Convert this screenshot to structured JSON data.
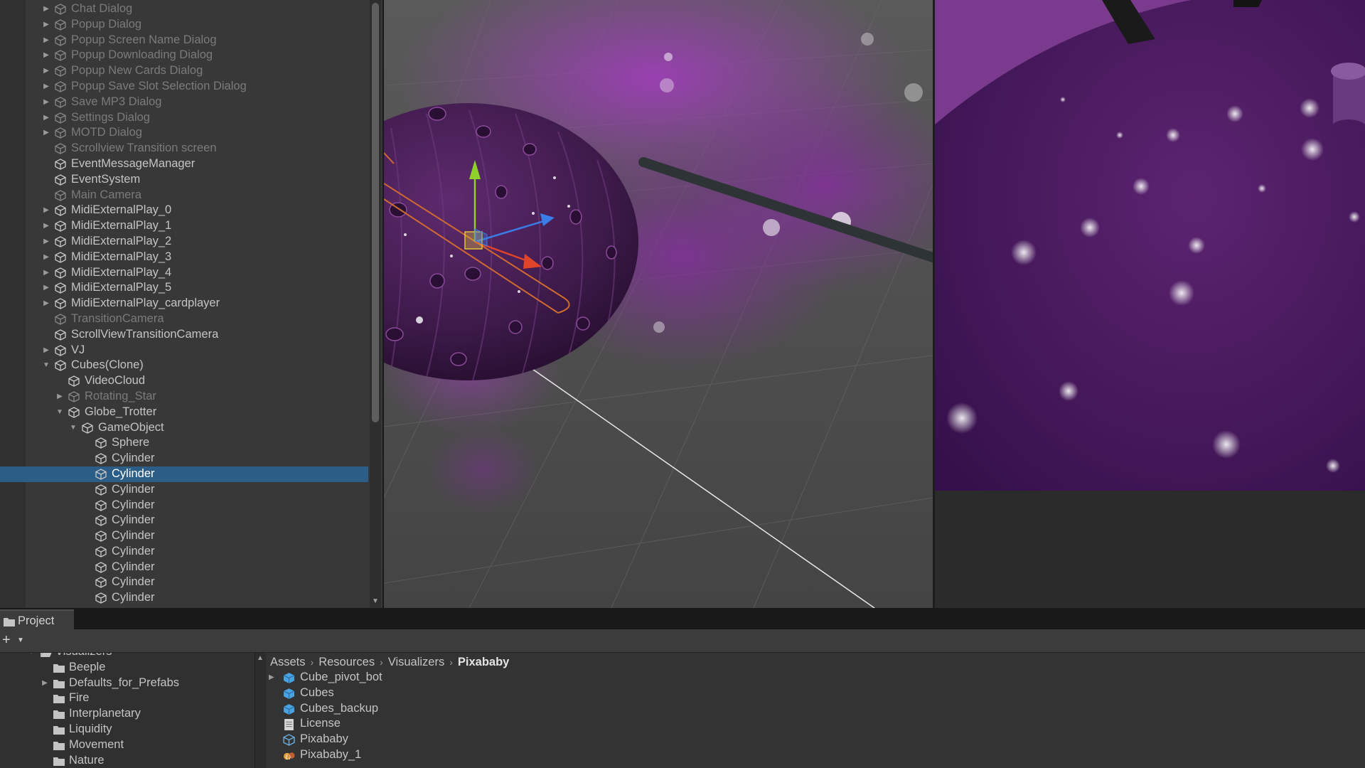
{
  "hierarchy": {
    "items": [
      {
        "label": "Chat Dialog",
        "depth": 0,
        "expander": "collapsed",
        "inactive": true
      },
      {
        "label": "Popup Dialog",
        "depth": 0,
        "expander": "collapsed",
        "inactive": true
      },
      {
        "label": "Popup Screen Name Dialog",
        "depth": 0,
        "expander": "collapsed",
        "inactive": true
      },
      {
        "label": "Popup Downloading Dialog",
        "depth": 0,
        "expander": "collapsed",
        "inactive": true
      },
      {
        "label": "Popup New Cards Dialog",
        "depth": 0,
        "expander": "collapsed",
        "inactive": true
      },
      {
        "label": "Popup Save Slot Selection Dialog",
        "depth": 0,
        "expander": "collapsed",
        "inactive": true
      },
      {
        "label": "Save MP3 Dialog",
        "depth": 0,
        "expander": "collapsed",
        "inactive": true
      },
      {
        "label": "Settings Dialog",
        "depth": 0,
        "expander": "collapsed",
        "inactive": true
      },
      {
        "label": "MOTD Dialog",
        "depth": 0,
        "expander": "collapsed",
        "inactive": true
      },
      {
        "label": "Scrollview Transition screen",
        "depth": 0,
        "expander": "none",
        "inactive": true
      },
      {
        "label": "EventMessageManager",
        "depth": 0,
        "expander": "none",
        "inactive": false
      },
      {
        "label": "EventSystem",
        "depth": 0,
        "expander": "none",
        "inactive": false
      },
      {
        "label": "Main Camera",
        "depth": 0,
        "expander": "none",
        "inactive": true
      },
      {
        "label": "MidiExternalPlay_0",
        "depth": 0,
        "expander": "collapsed",
        "inactive": false
      },
      {
        "label": "MidiExternalPlay_1",
        "depth": 0,
        "expander": "collapsed",
        "inactive": false
      },
      {
        "label": "MidiExternalPlay_2",
        "depth": 0,
        "expander": "collapsed",
        "inactive": false
      },
      {
        "label": "MidiExternalPlay_3",
        "depth": 0,
        "expander": "collapsed",
        "inactive": false
      },
      {
        "label": "MidiExternalPlay_4",
        "depth": 0,
        "expander": "collapsed",
        "inactive": false
      },
      {
        "label": "MidiExternalPlay_5",
        "depth": 0,
        "expander": "collapsed",
        "inactive": false
      },
      {
        "label": "MidiExternalPlay_cardplayer",
        "depth": 0,
        "expander": "collapsed",
        "inactive": false
      },
      {
        "label": "TransitionCamera",
        "depth": 0,
        "expander": "none",
        "inactive": true
      },
      {
        "label": "ScrollViewTransitionCamera",
        "depth": 0,
        "expander": "none",
        "inactive": false
      },
      {
        "label": "VJ",
        "depth": 0,
        "expander": "collapsed",
        "inactive": false
      },
      {
        "label": "Cubes(Clone)",
        "depth": 0,
        "expander": "expanded",
        "inactive": false
      },
      {
        "label": "VideoCloud",
        "depth": 1,
        "expander": "none",
        "inactive": false
      },
      {
        "label": "Rotating_Star",
        "depth": 1,
        "expander": "collapsed",
        "inactive": true
      },
      {
        "label": "Globe_Trotter",
        "depth": 1,
        "expander": "expanded",
        "inactive": false
      },
      {
        "label": "GameObject",
        "depth": 2,
        "expander": "expanded",
        "inactive": false
      },
      {
        "label": "Sphere",
        "depth": 3,
        "expander": "none",
        "inactive": false
      },
      {
        "label": "Cylinder",
        "depth": 3,
        "expander": "none",
        "inactive": false
      },
      {
        "label": "Cylinder",
        "depth": 3,
        "expander": "none",
        "inactive": false,
        "selected": true
      },
      {
        "label": "Cylinder",
        "depth": 3,
        "expander": "none",
        "inactive": false
      },
      {
        "label": "Cylinder",
        "depth": 3,
        "expander": "none",
        "inactive": false
      },
      {
        "label": "Cylinder",
        "depth": 3,
        "expander": "none",
        "inactive": false
      },
      {
        "label": "Cylinder",
        "depth": 3,
        "expander": "none",
        "inactive": false
      },
      {
        "label": "Cylinder",
        "depth": 3,
        "expander": "none",
        "inactive": false
      },
      {
        "label": "Cylinder",
        "depth": 3,
        "expander": "none",
        "inactive": false
      },
      {
        "label": "Cylinder",
        "depth": 3,
        "expander": "none",
        "inactive": false
      },
      {
        "label": "Cylinder",
        "depth": 3,
        "expander": "none",
        "inactive": false
      }
    ]
  },
  "project": {
    "tab_label": "Project",
    "add_label": "+",
    "folders": [
      {
        "label": "Visualizers",
        "depth": 0,
        "expander": "expanded",
        "open": true
      },
      {
        "label": "Beeple",
        "depth": 1,
        "expander": "none"
      },
      {
        "label": "Defaults_for_Prefabs",
        "depth": 1,
        "expander": "collapsed"
      },
      {
        "label": "Fire",
        "depth": 1,
        "expander": "none"
      },
      {
        "label": "Interplanetary",
        "depth": 1,
        "expander": "none"
      },
      {
        "label": "Liquidity",
        "depth": 1,
        "expander": "none"
      },
      {
        "label": "Movement",
        "depth": 1,
        "expander": "none"
      },
      {
        "label": "Nature",
        "depth": 1,
        "expander": "none"
      }
    ],
    "breadcrumb": [
      "Assets",
      "Resources",
      "Visualizers",
      "Pixababy"
    ],
    "assets": [
      {
        "label": "Cube_pivot_bot",
        "icon": "prefab-icon",
        "expander": "collapsed"
      },
      {
        "label": "Cubes",
        "icon": "prefab-icon",
        "expander": "none"
      },
      {
        "label": "Cubes_backup",
        "icon": "prefab-icon",
        "expander": "none"
      },
      {
        "label": "License",
        "icon": "text-file-icon",
        "expander": "none"
      },
      {
        "label": "Pixababy",
        "icon": "prefab-outline-icon",
        "expander": "none"
      },
      {
        "label": "Pixababy_1",
        "icon": "script-icon",
        "expander": "none"
      }
    ]
  },
  "colors": {
    "selection": "#2c5d87",
    "scene_purple": "#7a2f8f",
    "gizmo_y": "#8fd12a",
    "gizmo_x": "#e0442a",
    "gizmo_z": "#3b7de8",
    "gizmo_center": "#e6c23a"
  }
}
